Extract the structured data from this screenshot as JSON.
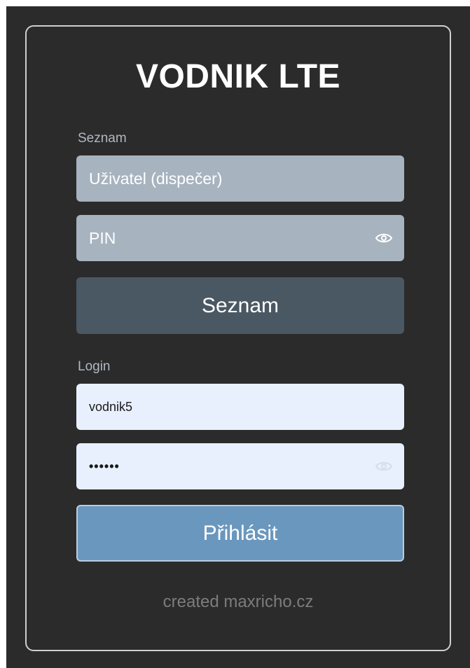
{
  "app": {
    "title": "VODNIK LTE"
  },
  "list_section": {
    "label": "Seznam",
    "user_placeholder": "Uživatel (dispečer)",
    "pin_placeholder": "PIN",
    "button_label": "Seznam"
  },
  "login_section": {
    "label": "Login",
    "username_value": "vodnik5",
    "password_value": "••••••",
    "button_label": "Přihlásit"
  },
  "footer": {
    "credit": "created maxricho.cz"
  },
  "colors": {
    "background": "#2b2b2b",
    "input_grey": "#a7b3bf",
    "input_light": "#e8f0fe",
    "button_dark": "#4a5864",
    "button_blue": "#6a97bd"
  },
  "icons": {
    "pin_toggle": "eye-icon",
    "password_toggle": "eye-icon"
  }
}
